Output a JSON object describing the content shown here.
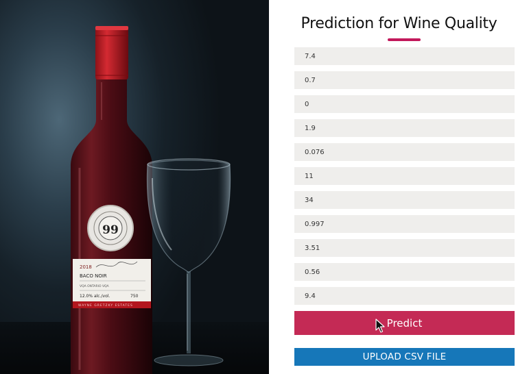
{
  "form": {
    "title": "Prediction for Wine Quality",
    "fields": [
      "7.4",
      "0.7",
      "0",
      "1.9",
      "0.076",
      "11",
      "34",
      "0.997",
      "3.51",
      "0.56",
      "9.4"
    ],
    "predict_label": "Predict",
    "upload_label": "UPLOAD CSV FILE"
  },
  "photo": {
    "label": {
      "number": "99",
      "year": "2018",
      "name": "BACO NOIR",
      "region": "VQA ONTARIO VQA",
      "alcohol": "12.0% alc./vol.",
      "volume": "750",
      "band": "WAYNE GRETZKY ESTATES"
    }
  },
  "colors": {
    "accent": "#c2185b",
    "predict_button": "#c42a55",
    "upload_button": "#1677b9",
    "field_bg": "#efeeec"
  },
  "icons": {
    "cursor": "mouse-pointer-icon"
  }
}
